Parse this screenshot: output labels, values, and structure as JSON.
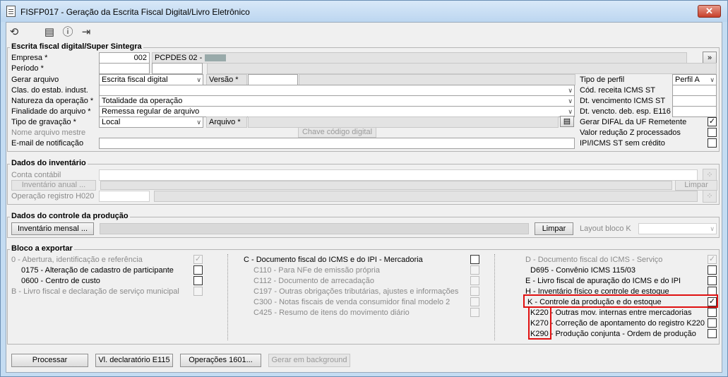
{
  "window": {
    "title": "FISFP017 - Geração da Escrita Fiscal Digital/Livro Eletrônico",
    "close": "✕"
  },
  "toolbar": {
    "refresh_icon": "refresh-icon",
    "calendar_icon": "calendar-icon",
    "help_icon": "help-icon",
    "exit_icon": "exit-icon"
  },
  "sped": {
    "title": "Escrita fiscal digital/Super Sintegra",
    "empresa_label": "Empresa *",
    "empresa_code": "002",
    "empresa_name": "PCPDES 02 -",
    "more_btn": "»",
    "periodo_label": "Período *",
    "gerar_label": "Gerar arquivo",
    "gerar_value": "Escrita fiscal digital",
    "versao_label": "Versão *",
    "clas_label": "Clas. do estab. indust.",
    "natureza_label": "Natureza da operação *",
    "natureza_value": "Totalidade da operação",
    "finalidade_label": "Finalidade do arquivo *",
    "finalidade_value": "Remessa regular de arquivo",
    "tipo_grav_label": "Tipo de gravação *",
    "tipo_grav_value": "Local",
    "arquivo_label": "Arquivo *",
    "nome_label": "Nome arquivo mestre",
    "chave_btn": "Chave código digital",
    "email_label": "E-mail de notificação",
    "tipo_perfil_label": "Tipo de perfil",
    "tipo_perfil_value": "Perfil A",
    "cod_receita_label": "Cód. receita ICMS ST",
    "dt_venc_label": "Dt. vencimento ICMS ST",
    "dt_vencto_label": "Dt. vencto. deb. esp. E116",
    "difal_label": "Gerar DIFAL da UF Remetente",
    "reducao_label": "Valor redução Z processados",
    "ipi_label": "IPI/ICMS ST sem crédito"
  },
  "inventario": {
    "title": "Dados do inventário",
    "conta_label": "Conta contábil",
    "anual_btn": "Inventário anual ...",
    "limpar_btn": "Limpar",
    "h020_label": "Operação registro H020"
  },
  "producao": {
    "title": "Dados do controle da produção",
    "mensal_btn": "Inventário mensal ...",
    "limpar_btn": "Limpar",
    "layout_label": "Layout bloco K"
  },
  "bloco": {
    "title": "Bloco a exportar",
    "col1": [
      {
        "label": "0 - Abertura, identificação e referência",
        "checked": true,
        "disabled": true
      },
      {
        "label": "0175 - Alteração de cadastro de participante",
        "checked": false,
        "disabled": false
      },
      {
        "label": "0600 - Centro de custo",
        "checked": false,
        "disabled": false
      },
      {
        "label": "B - Livro fiscal e declaração de serviço municipal",
        "checked": false,
        "disabled": true
      }
    ],
    "col2": [
      {
        "label": "C - Documento fiscal do ICMS e do IPI - Mercadoria",
        "checked": false,
        "disabled": false
      },
      {
        "label": "C110 - Para NFe de emissão própria",
        "checked": false,
        "disabled": true
      },
      {
        "label": "C112 - Documento de arrecadação",
        "checked": false,
        "disabled": true
      },
      {
        "label": "C197 - Outras obrigações tributárias, ajustes e informações",
        "checked": false,
        "disabled": true
      },
      {
        "label": "C300 - Notas fiscais de venda consumidor final modelo 2",
        "checked": false,
        "disabled": true
      },
      {
        "label": "C425 - Resumo de itens do movimento diário",
        "checked": false,
        "disabled": true
      }
    ],
    "col3": [
      {
        "label": "D - Documento fiscal do ICMS - Serviço",
        "checked": true,
        "disabled": true
      },
      {
        "label": "D695 - Convênio ICMS 115/03",
        "checked": false,
        "disabled": false
      },
      {
        "label": "E - Livro fiscal de apuração do ICMS e do IPI",
        "checked": false,
        "disabled": false
      },
      {
        "label": "H - Inventário físico e controle de estoque",
        "checked": false,
        "disabled": false
      },
      {
        "label": "K - Controle da produção e do estoque",
        "checked": true,
        "disabled": false
      },
      {
        "label": "K220 - Outras mov. internas entre mercadorias",
        "checked": false,
        "disabled": false
      },
      {
        "label": "K270 - Correção de apontamento do registro K220",
        "checked": false,
        "disabled": false
      },
      {
        "label": "K290 - Produção conjunta - Ordem de produção",
        "checked": false,
        "disabled": false
      }
    ]
  },
  "footer": {
    "processar_btn": "Processar",
    "vl_btn": "Vl. declaratório E115",
    "operacoes_btn": "Operações 1601...",
    "background_btn": "Gerar em background"
  },
  "colors": {
    "highlight": "#e01010"
  }
}
